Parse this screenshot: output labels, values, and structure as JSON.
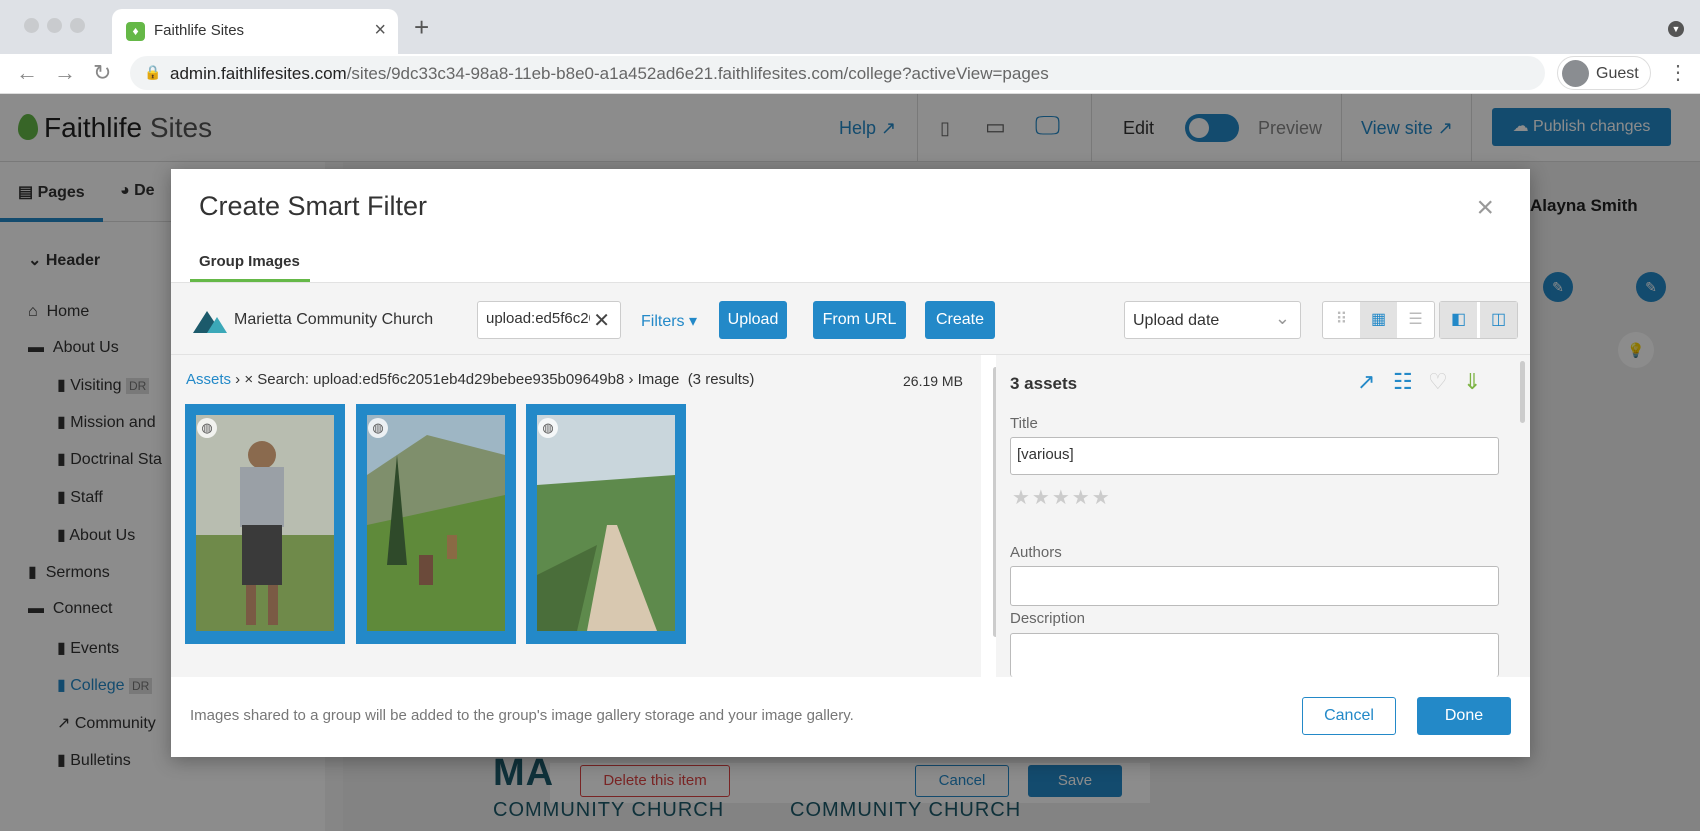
{
  "browser": {
    "tab_title": "Faithlife Sites",
    "url_host": "admin.faithlifesites.com",
    "url_path": "/sites/9dc33c34-98a8-11eb-b8e0-a1a452ad6e21.faithlifesites.com/college?activeView=pages",
    "profile_label": "Guest"
  },
  "app": {
    "logo_brand": "Faithlife",
    "logo_product": "Sites",
    "help": "Help",
    "edit": "Edit",
    "preview": "Preview",
    "view_site": "View site",
    "publish": "Publish changes",
    "user_name": "Alayna Smith",
    "sidebar_tabs": [
      "Pages",
      "De"
    ],
    "sidebar": {
      "header": "Header",
      "items": [
        {
          "label": "Home",
          "badge": ""
        },
        {
          "label": "About Us",
          "badge": ""
        },
        {
          "label": "Visiting",
          "badge": "DR"
        },
        {
          "label": "Mission and",
          "badge": ""
        },
        {
          "label": "Doctrinal Sta",
          "badge": ""
        },
        {
          "label": "Staff",
          "badge": ""
        },
        {
          "label": "About Us",
          "badge": ""
        },
        {
          "label": "Sermons",
          "badge": ""
        },
        {
          "label": "Connect",
          "badge": ""
        },
        {
          "label": "Events",
          "badge": ""
        },
        {
          "label": "College",
          "badge": "DR"
        },
        {
          "label": "Community",
          "badge": ""
        },
        {
          "label": "Bulletins",
          "badge": ""
        }
      ]
    },
    "behind": {
      "delete": "Delete this item",
      "cancel": "Cancel",
      "save": "Save",
      "church_text_1": "COMMUNITY CHURCH",
      "church_text_2": "COMMUNITY CHURCH",
      "ma": "MA"
    }
  },
  "modal": {
    "title": "Create Smart Filter",
    "tab": "Group Images",
    "church": "Marietta Community Church",
    "search_value": "upload:ed5f6c2051eb4d29bebee935b09649b8",
    "filters": "Filters",
    "buttons": {
      "upload": "Upload",
      "from_url": "From URL",
      "create": "Create"
    },
    "sort": "Upload date",
    "breadcrumb": {
      "assets": "Assets",
      "search": "× Search: upload:ed5f6c2051eb4d29bebee935b09649b8",
      "type": "Image",
      "results": "(3 results)"
    },
    "size": "26.19 MB",
    "details": {
      "count": "3 assets",
      "title_label": "Title",
      "title_value": "[various]",
      "authors_label": "Authors",
      "authors_value": "",
      "description_label": "Description",
      "rating": 0
    },
    "footnote": "Images shared to a group will be added to the group's image gallery storage and your image gallery.",
    "cancel": "Cancel",
    "done": "Done"
  },
  "colors": {
    "accent": "#2389c8",
    "brand_green": "#65b847"
  }
}
